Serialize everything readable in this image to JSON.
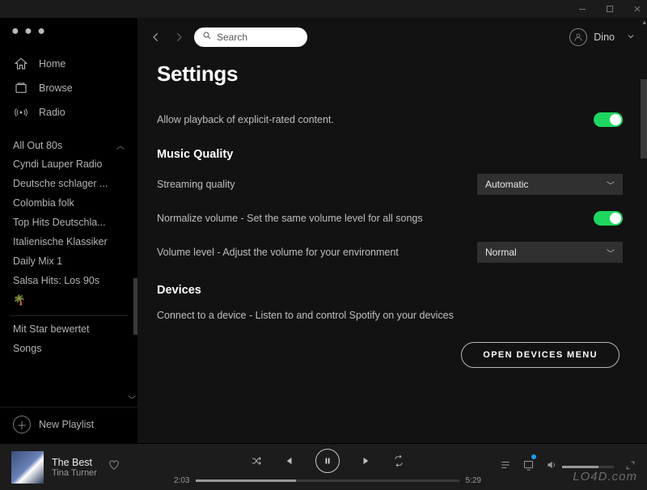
{
  "titlebar": {
    "minimize": "—",
    "maximize": "☐",
    "close": "✕"
  },
  "sidebar": {
    "nav": [
      {
        "label": "Home",
        "icon": "home-icon"
      },
      {
        "label": "Browse",
        "icon": "browse-icon"
      },
      {
        "label": "Radio",
        "icon": "radio-icon"
      }
    ],
    "playlists": [
      "All Out 80s",
      "Cyndi Lauper Radio",
      "Deutsche schlager ...",
      "Colombia folk",
      "Top Hits Deutschla...",
      "Italienische Klassiker",
      "Daily Mix 1",
      "Salsa Hits: Los 90s",
      "🌴",
      "Mit Star bewertet",
      "Songs"
    ],
    "new_playlist": "New Playlist"
  },
  "topbar": {
    "search_placeholder": "Search",
    "username": "Dino"
  },
  "settings": {
    "title": "Settings",
    "explicit_label": "Allow playback of explicit-rated content.",
    "explicit_on": true,
    "section_quality": "Music Quality",
    "streaming_quality_label": "Streaming quality",
    "streaming_quality_value": "Automatic",
    "normalize_label": "Normalize volume - Set the same volume level for all songs",
    "normalize_on": true,
    "volume_level_label": "Volume level - Adjust the volume for your environment",
    "volume_level_value": "Normal",
    "section_devices": "Devices",
    "devices_desc": "Connect to a device - Listen to and control Spotify on your devices",
    "devices_button": "OPEN DEVICES MENU"
  },
  "player": {
    "track_title": "The Best",
    "track_artist": "Tina Turner",
    "elapsed": "2:03",
    "total": "5:29"
  },
  "watermark": "LO4D.com"
}
